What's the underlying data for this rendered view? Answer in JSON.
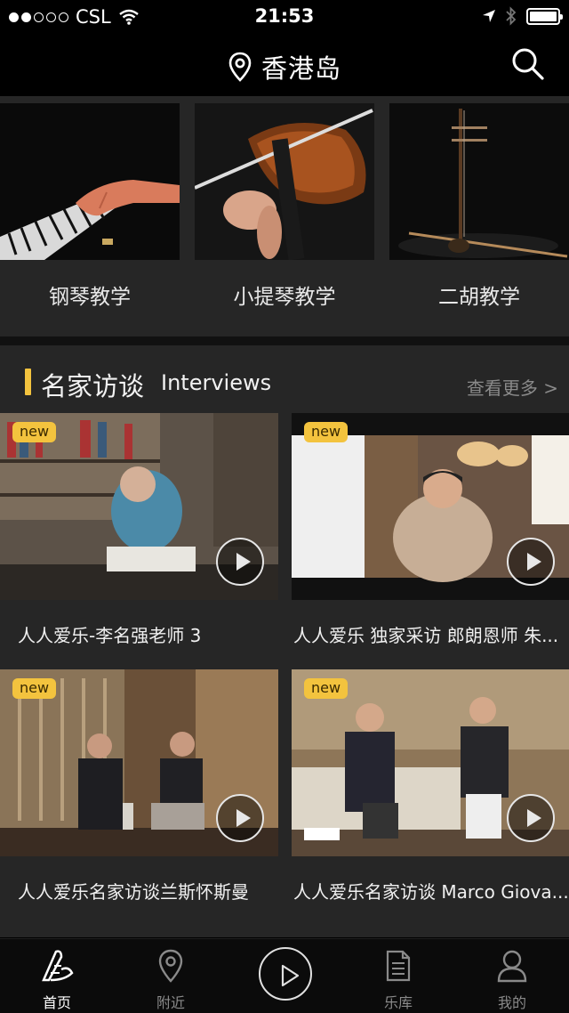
{
  "status_bar": {
    "carrier": "CSL",
    "time": "21:53"
  },
  "header": {
    "location": "香港岛"
  },
  "categories": [
    {
      "label": "钢琴教学"
    },
    {
      "label": "小提琴教学"
    },
    {
      "label": "二胡教学"
    }
  ],
  "interviews": {
    "title": "名家访谈",
    "subtitle": "Interviews",
    "more": "查看更多 >",
    "cards": [
      {
        "badge": "new",
        "title": "人人爱乐-李名强老师 3"
      },
      {
        "badge": "new",
        "title": "人人爱乐 独家采访 郎朗恩师 朱..."
      },
      {
        "badge": "new",
        "title": "人人爱乐名家访谈兰斯怀斯曼"
      },
      {
        "badge": "new",
        "title": "人人爱乐名家访谈 Marco Giova..."
      }
    ]
  },
  "tabbar": {
    "tabs": [
      {
        "label": "首页"
      },
      {
        "label": "附近"
      },
      {
        "label": "乐库"
      },
      {
        "label": "我的"
      }
    ]
  },
  "colors": {
    "accent": "#f3c33e",
    "panel": "#262626",
    "background": "#000000"
  }
}
